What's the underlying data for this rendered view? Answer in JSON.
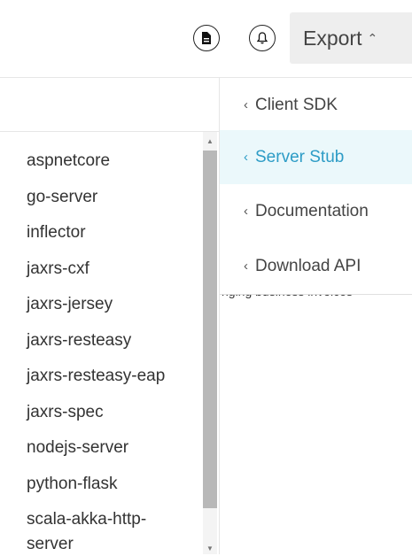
{
  "toolbar": {
    "doc_icon": "document-icon",
    "bell_icon": "bell-icon",
    "export_label": "Export",
    "export_chevron": "⌃"
  },
  "export_menu": {
    "items": [
      {
        "chevron": "‹",
        "label": "Client SDK",
        "active": false
      },
      {
        "chevron": "‹",
        "label": "Server Stub",
        "active": true
      },
      {
        "chevron": "‹",
        "label": "Documentation",
        "active": false
      },
      {
        "chevron": "‹",
        "label": "Download API",
        "active": false
      }
    ]
  },
  "server_stub_list": {
    "items": [
      "aspnetcore",
      "go-server",
      "inflector",
      "jaxrs-cxf",
      "jaxrs-jersey",
      "jaxrs-resteasy",
      "jaxrs-resteasy-eap",
      "jaxrs-spec",
      "nodejs-server",
      "python-flask",
      "scala-akka-http-",
      "server"
    ]
  },
  "background": {
    "partial_text": "nging business invoices"
  },
  "colors": {
    "accent": "#2d9cc6",
    "active_bg": "#ebf8fb",
    "button_bg": "#eeeeee"
  }
}
